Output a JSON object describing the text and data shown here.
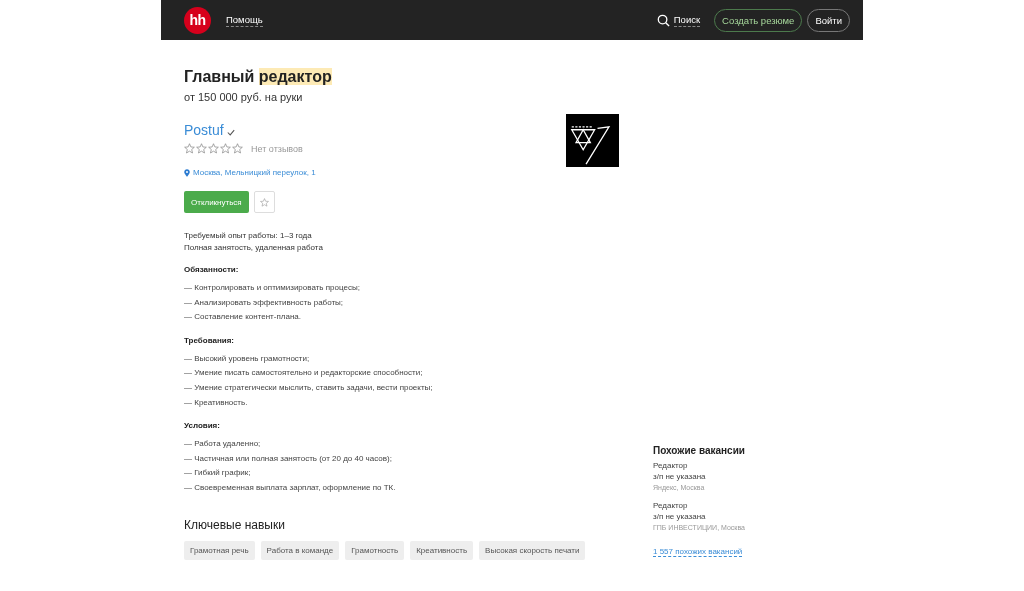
{
  "header": {
    "logo": "hh",
    "help_link": "Помощь",
    "search": "Поиск",
    "create_resume": "Создать резюме",
    "login": "Войти"
  },
  "vacancy": {
    "title_parts": [
      {
        "text": "Главный ",
        "highlighted": false
      },
      {
        "text": "редактор",
        "highlighted": true
      }
    ],
    "salary": "от 150 000 руб. на руки",
    "company": "Postuf",
    "verified": true,
    "stars": 0,
    "reviews": "Нет отзывов",
    "address": "Москва, Мельницкий переулок, 1",
    "apply_button": "Откликнуться",
    "favorite": false,
    "experience": "Требуемый опыт работы: 1–3 года",
    "employment": "Полная занятость, удаленная работа",
    "sections": [
      {
        "heading": "Обязанности:",
        "items": [
          "— Контролировать и оптимизировать процесы;",
          "— Анализировать эффективность работы;",
          "— Составление контент-плана."
        ]
      },
      {
        "heading": "Требования:",
        "items": [
          "— Высокий уровень грамотности;",
          "— Умение писать самостоятельно и редакторские способности;",
          "— Умение стратегически мыслить, ставить задачи, вести проекты;",
          "— Креативность."
        ]
      },
      {
        "heading": "Условия:",
        "items": [
          "— Работа удаленно;",
          "— Частичная или полная занятость (от 20 до 40 часов);",
          "— Гибкий график;",
          "— Своевременная выплата зарплат, оформление по ТК."
        ]
      }
    ],
    "skills_heading": "Ключевые навыки",
    "skills": [
      "Грамотная речь",
      "Работа в команде",
      "Грамотность",
      "Креативность",
      "Высокая скорость печати"
    ]
  },
  "similar": {
    "heading": "Похожие вакансии",
    "items": [
      {
        "title": "Редактор",
        "salary": "з/п не указана",
        "company": "Яндекс, Москва"
      },
      {
        "title": "Редактор",
        "salary": "з/п не указана",
        "company": "ГПБ ИНВЕСТИЦИИ, Москва"
      }
    ],
    "more_link": "1 557 похожих вакансий"
  }
}
